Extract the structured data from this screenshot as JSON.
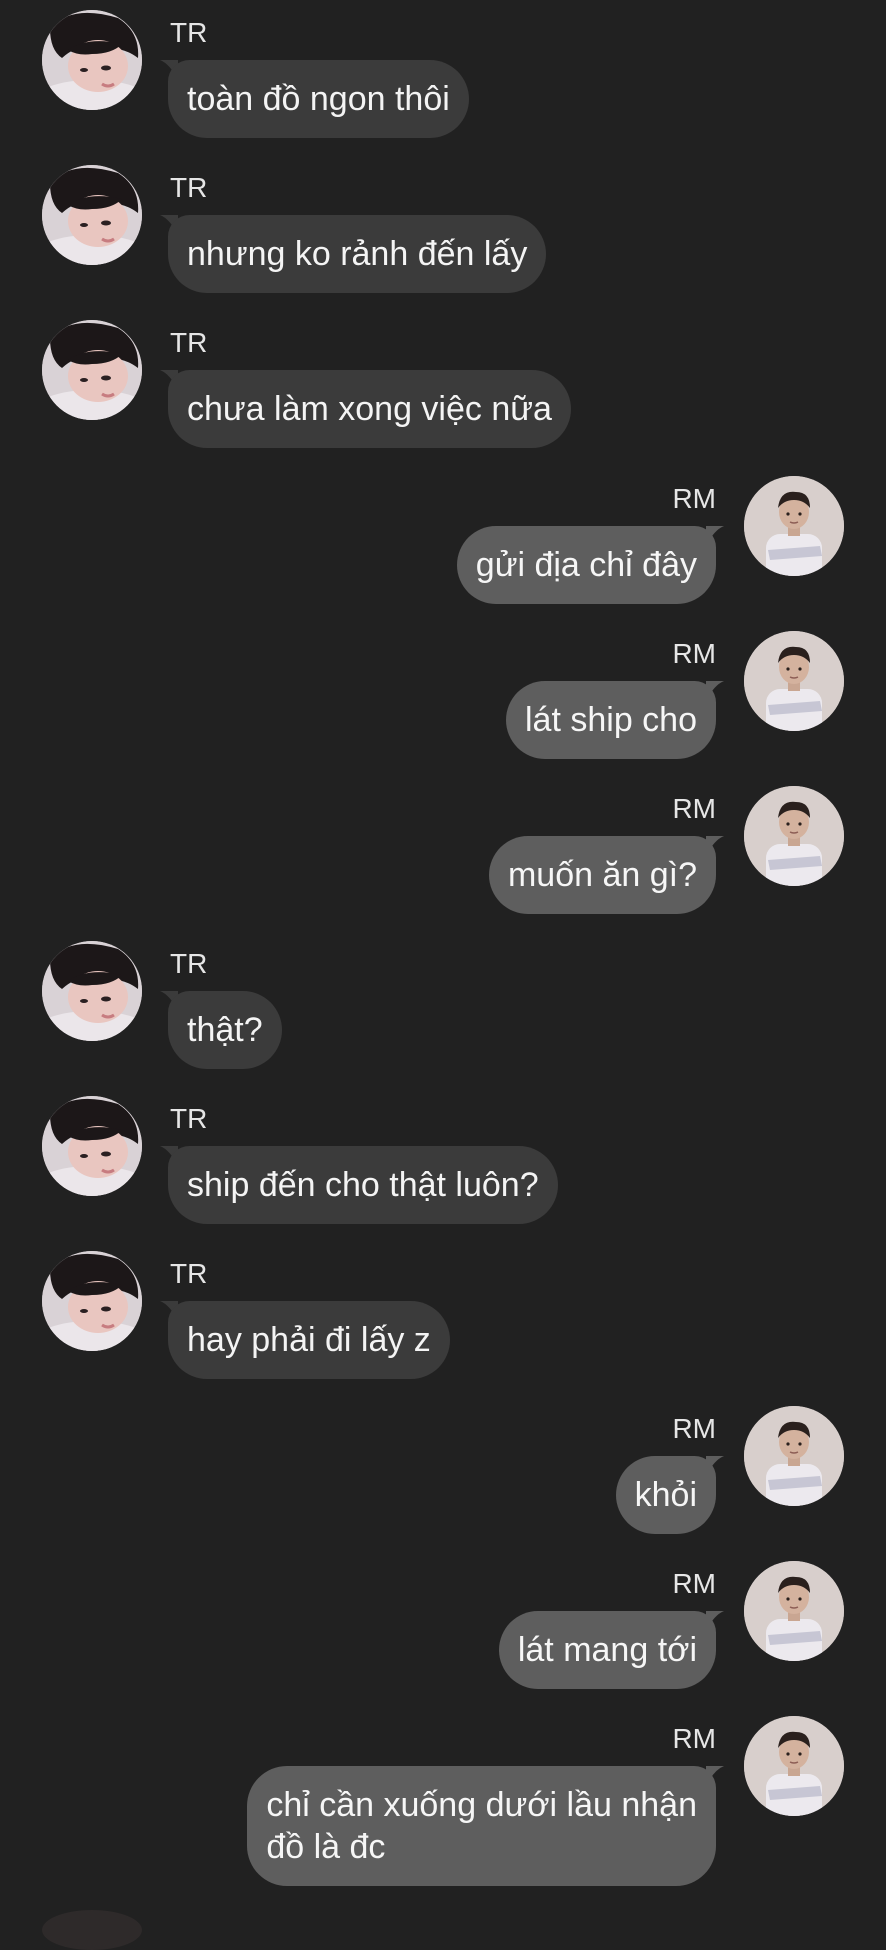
{
  "colors": {
    "background": "#212121",
    "incoming_bubble": "#3b3b3b",
    "outgoing_bubble": "#5e5e5e",
    "text": "#f2f2f2"
  },
  "messages": [
    {
      "sender": "TR",
      "direction": "in",
      "text": "toàn đồ ngon thôi",
      "avatar": "avatar-tr-icon"
    },
    {
      "sender": "TR",
      "direction": "in",
      "text": "nhưng ko rảnh đến lấy",
      "avatar": "avatar-tr-icon"
    },
    {
      "sender": "TR",
      "direction": "in",
      "text": "chưa làm xong việc nữa",
      "avatar": "avatar-tr-icon"
    },
    {
      "sender": "RM",
      "direction": "out",
      "text": "gửi địa chỉ đây",
      "avatar": "avatar-rm-icon"
    },
    {
      "sender": "RM",
      "direction": "out",
      "text": "lát ship cho",
      "avatar": "avatar-rm-icon"
    },
    {
      "sender": "RM",
      "direction": "out",
      "text": "muốn ăn gì?",
      "avatar": "avatar-rm-icon"
    },
    {
      "sender": "TR",
      "direction": "in",
      "text": "thật?",
      "avatar": "avatar-tr-icon"
    },
    {
      "sender": "TR",
      "direction": "in",
      "text": "ship đến cho thật luôn?",
      "avatar": "avatar-tr-icon"
    },
    {
      "sender": "TR",
      "direction": "in",
      "text": "hay phải đi lấy z",
      "avatar": "avatar-tr-icon"
    },
    {
      "sender": "RM",
      "direction": "out",
      "text": "khỏi",
      "avatar": "avatar-rm-icon"
    },
    {
      "sender": "RM",
      "direction": "out",
      "text": "lát mang tới",
      "avatar": "avatar-rm-icon"
    },
    {
      "sender": "RM",
      "direction": "out",
      "text": "chỉ cần xuống dưới lầu nhận\nđồ là đc",
      "avatar": "avatar-rm-icon"
    }
  ]
}
